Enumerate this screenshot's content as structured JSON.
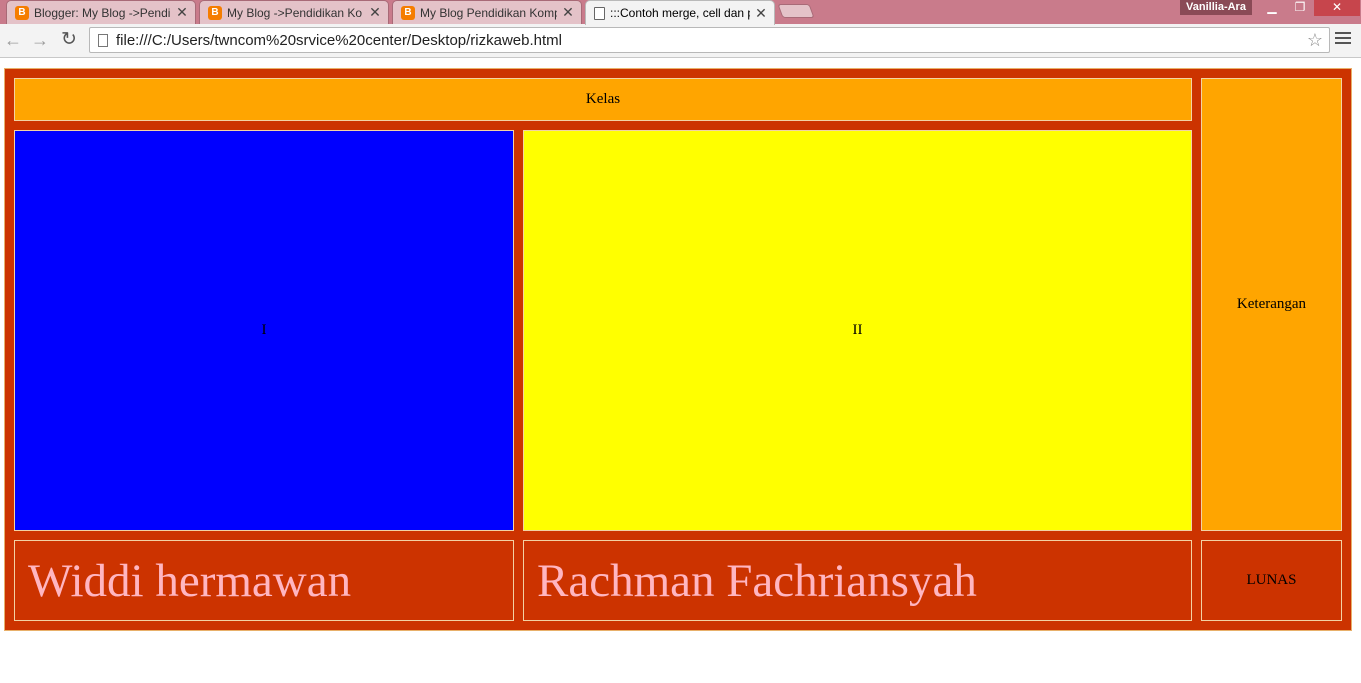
{
  "browser": {
    "tabs": [
      {
        "title": "Blogger: My Blog ->Pendi",
        "favicon": "blogger-icon",
        "active": false
      },
      {
        "title": "My Blog ->Pendidikan Ko",
        "favicon": "blogger-icon",
        "active": false
      },
      {
        "title": "My Blog Pendidikan Komp",
        "favicon": "blogger-icon",
        "active": false
      },
      {
        "title": ":::Contoh merge, cell dan p",
        "favicon": "page-icon",
        "active": true
      }
    ],
    "tab_close_glyph": "✕",
    "profile_name": "Vanillia-Ara",
    "url": "file:///C:/Users/twncom%20srvice%20center/Desktop/rizkaweb.html"
  },
  "table": {
    "header": "Kelas",
    "col1": "I",
    "col2": "II",
    "note": "Keterangan",
    "name1": "Widdi hermawan",
    "name2": "Rachman Fachriansyah",
    "status": "LUNAS"
  },
  "colors": {
    "table_bg": "#cc3300",
    "header_bg": "#ffa500",
    "col1_bg": "#0000ff",
    "col2_bg": "#ffff00",
    "name_text": "#ffb6c1"
  }
}
